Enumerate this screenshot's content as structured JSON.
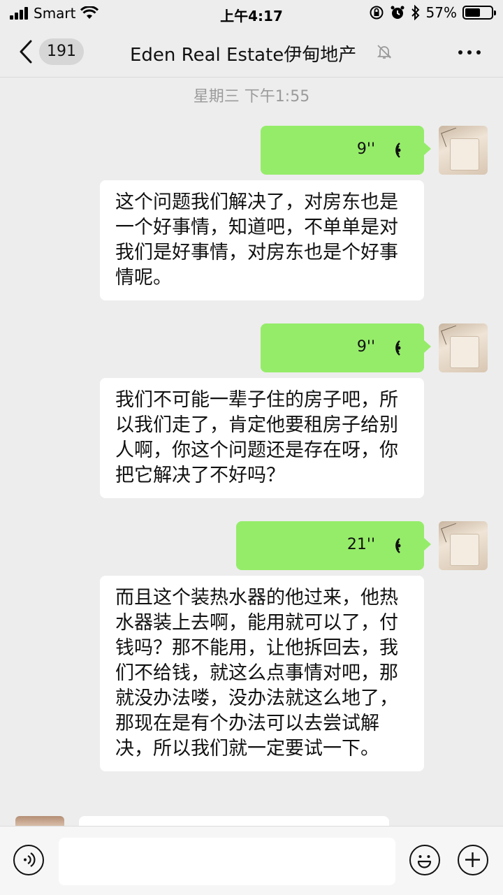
{
  "status_bar": {
    "carrier": "Smart",
    "time": "上午4:17",
    "battery": "57%",
    "battery_level": 0.57
  },
  "header": {
    "back_count": "191",
    "title": "Eden Real Estate伊甸地产"
  },
  "chat": {
    "timestamp": "星期三 下午1:55",
    "messages": [
      {
        "type": "voice",
        "duration": "9''"
      },
      {
        "type": "text",
        "text": "这个问题我们解决了，对房东也是一个好事情，知道吧，不单单是对我们是好事情，对房东也是个好事情呢。"
      },
      {
        "type": "voice",
        "duration": "9''"
      },
      {
        "type": "text",
        "text": "我们不可能一辈子住的房子吧，所以我们走了，肯定他要租房子给别人啊，你这个问题还是存在呀，你把它解决了不好吗？"
      },
      {
        "type": "voice",
        "duration": "21''"
      },
      {
        "type": "text",
        "text": "而且这个装热水器的他过来，他热水器装上去啊，能用就可以了，付钱吗？那不能用，让他拆回去，我们不给钱，就这么点事情对吧，那就没办法喽，没办法就这么地了，那现在是有个办法可以去尝试解决，所以我们就一定要试一下。"
      }
    ]
  },
  "input": {
    "value": ""
  },
  "colors": {
    "voice_bubble": "#95ec69",
    "background": "#ededed"
  }
}
